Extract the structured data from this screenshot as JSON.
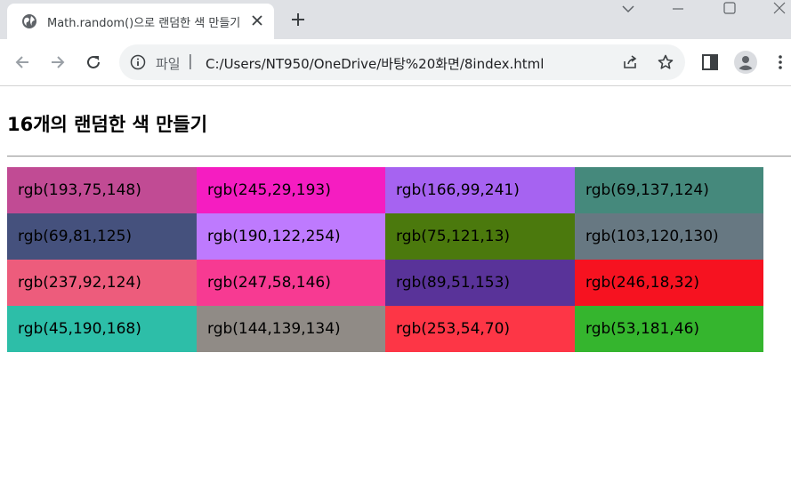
{
  "browser": {
    "tab": {
      "title": "Math.random()으로 랜덤한 색 만들기"
    },
    "address": {
      "scheme": "파일",
      "separator": "|",
      "url": "C:/Users/NT950/OneDrive/바탕%20화면/8index.html"
    },
    "icons": {
      "favicon": "globe-icon",
      "close": "close-icon",
      "new_tab": "plus-icon",
      "tab_search": "chevron-down-icon",
      "minimize": "minimize-icon",
      "maximize": "maximize-icon",
      "window_close": "close-icon",
      "back": "arrow-left-icon",
      "forward": "arrow-right-icon",
      "reload": "reload-icon",
      "info": "info-icon",
      "share": "share-icon",
      "bookmark": "star-icon",
      "side_panel": "side-panel-icon",
      "profile": "profile-icon",
      "menu": "kebab-menu-icon"
    }
  },
  "page": {
    "title": "16개의 랜덤한 색 만들기",
    "colors": [
      "rgb(193,75,148)",
      "rgb(245,29,193)",
      "rgb(166,99,241)",
      "rgb(69,137,124)",
      "rgb(69,81,125)",
      "rgb(190,122,254)",
      "rgb(75,121,13)",
      "rgb(103,120,130)",
      "rgb(237,92,124)",
      "rgb(247,58,146)",
      "rgb(89,51,153)",
      "rgb(246,18,32)",
      "rgb(45,190,168)",
      "rgb(144,139,134)",
      "rgb(253,54,70)",
      "rgb(53,181,46)"
    ]
  }
}
